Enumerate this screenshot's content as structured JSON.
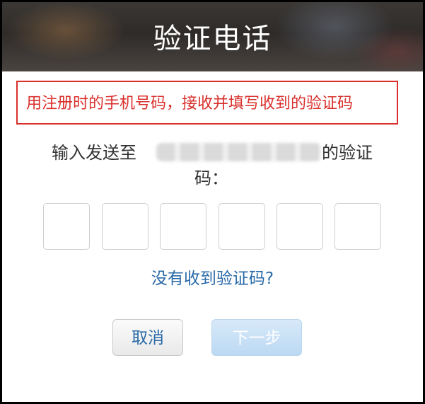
{
  "header": {
    "title": "验证电话"
  },
  "instruction": {
    "text": "用注册时的手机号码，接收并填写收到的验证码",
    "color": "#d9302c"
  },
  "prompt": {
    "prefix": "输入发送至",
    "suffix": "的验证",
    "line2": "码："
  },
  "code_inputs": [
    "",
    "",
    "",
    "",
    "",
    ""
  ],
  "resend_link": "没有收到验证码?",
  "buttons": {
    "cancel": "取消",
    "next": "下一步",
    "next_state": "disabled"
  },
  "colors": {
    "link": "#2a6aa8",
    "next_button_bg": "#c5ddf4"
  }
}
